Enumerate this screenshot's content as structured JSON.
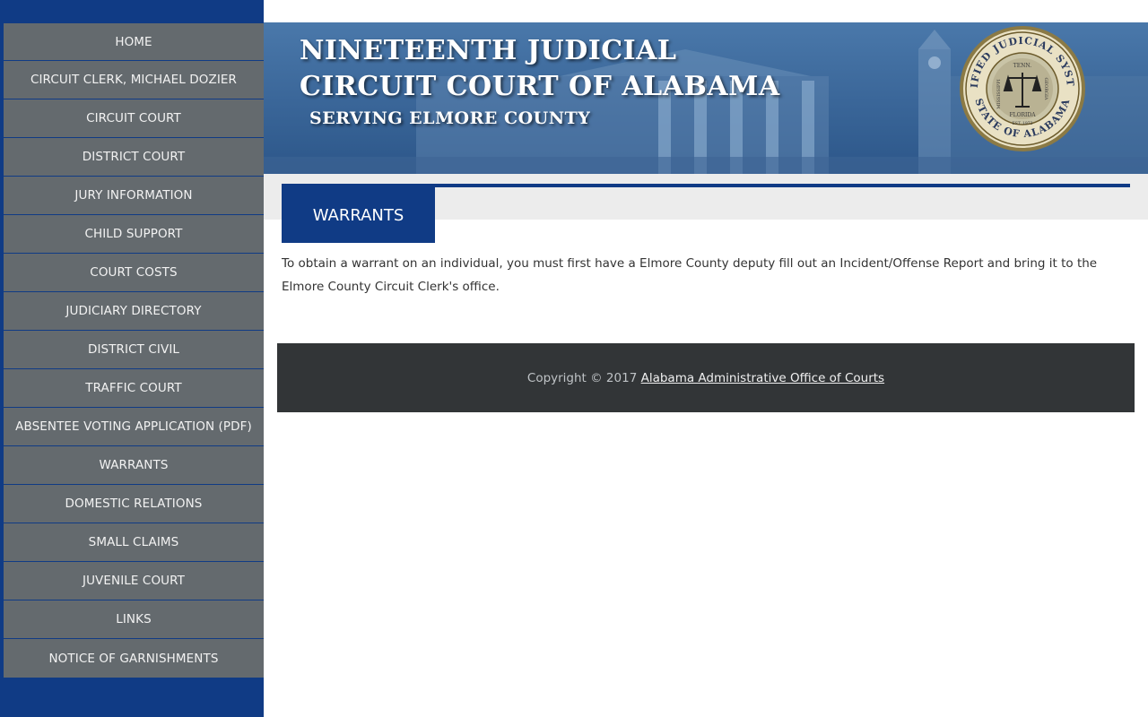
{
  "sidebar": {
    "items": [
      {
        "label": "HOME"
      },
      {
        "label": "CIRCUIT CLERK, MICHAEL DOZIER"
      },
      {
        "label": "CIRCUIT COURT"
      },
      {
        "label": "DISTRICT COURT"
      },
      {
        "label": "JURY INFORMATION"
      },
      {
        "label": "CHILD SUPPORT"
      },
      {
        "label": "COURT COSTS"
      },
      {
        "label": "JUDICIARY DIRECTORY"
      },
      {
        "label": "DISTRICT CIVIL"
      },
      {
        "label": "TRAFFIC COURT"
      },
      {
        "label": "ABSENTEE VOTING APPLICATION (PDF)"
      },
      {
        "label": "WARRANTS"
      },
      {
        "label": "DOMESTIC RELATIONS"
      },
      {
        "label": "SMALL CLAIMS"
      },
      {
        "label": "JUVENILE COURT"
      },
      {
        "label": "LINKS"
      },
      {
        "label": "NOTICE OF GARNISHMENTS"
      }
    ]
  },
  "banner": {
    "title_line1": "NINETEENTH JUDICIAL",
    "title_line2": "CIRCUIT COURT OF ALABAMA",
    "subtitle": "SERVING ELMORE COUNTY",
    "seal": {
      "top_text": "UNIFIED JUDICIAL SYSTEM",
      "bottom_text": "STATE OF ALABAMA",
      "left_text": "MISSISSIPPI",
      "right_text": "GEORGIA",
      "center_top": "TENN.",
      "center_bottom": "FLORIDA",
      "est": "EST. 1973"
    }
  },
  "main": {
    "title": "WARRANTS",
    "body": "To obtain a warrant on an individual, you must first have a Elmore County deputy fill out an Incident/Offense Report and bring it to the Elmore County Circuit Clerk's office."
  },
  "footer": {
    "copyright": "Copyright © 2017",
    "link_text": "Alabama Administrative Office of Courts"
  },
  "colors": {
    "brand_blue": "#103b85",
    "nav_gray": "#646a6e",
    "footer_dark": "#323537"
  }
}
